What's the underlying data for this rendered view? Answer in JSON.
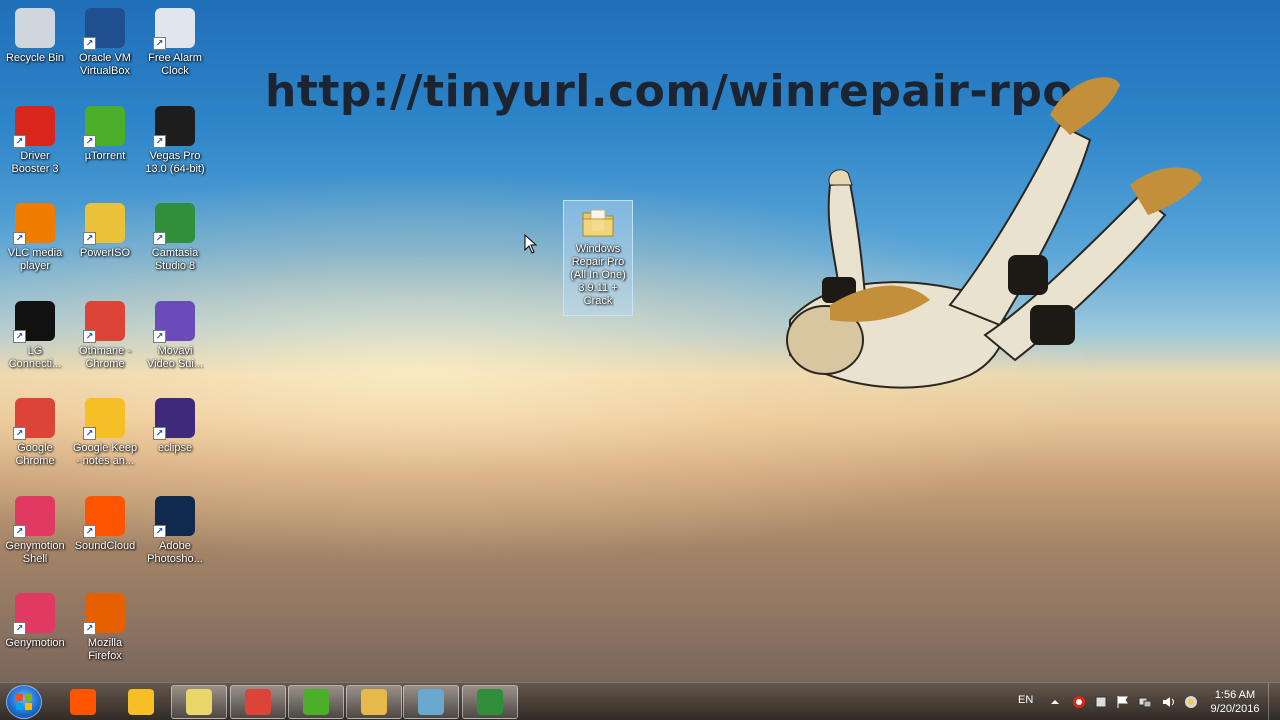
{
  "overlay_url": "http://tinyurl.com/winrepair-rpo",
  "desktop_icons": [
    {
      "label": "Recycle Bin",
      "icon": "recycle-bin-icon",
      "color": "#cfd6dc"
    },
    {
      "label": "Oracle VM\nVirtualBox",
      "icon": "virtualbox-icon",
      "color": "#1f4f8f"
    },
    {
      "label": "Free Alarm\nClock",
      "icon": "alarm-clock-icon",
      "color": "#dfe6ee"
    },
    {
      "label": "Driver\nBooster 3",
      "icon": "driver-booster-icon",
      "color": "#d8261c"
    },
    {
      "label": "µTorrent",
      "icon": "utorrent-icon",
      "color": "#4caf2a"
    },
    {
      "label": "Vegas Pro\n13.0 (64-bit)",
      "icon": "vegas-pro-icon",
      "color": "#1d1d1d"
    },
    {
      "label": "VLC media\nplayer",
      "icon": "vlc-icon",
      "color": "#f07d00"
    },
    {
      "label": "PowerISO",
      "icon": "poweriso-icon",
      "color": "#e9c23a"
    },
    {
      "label": "Camtasia\nStudio 8",
      "icon": "camtasia-icon",
      "color": "#2f8f3a"
    },
    {
      "label": "LG\nConnecti...",
      "icon": "lg-connection-icon",
      "color": "#111111"
    },
    {
      "label": "Othmane -\nChrome",
      "icon": "chrome-profile-icon",
      "color": "#db4437"
    },
    {
      "label": "Movavi\nVideo Sui...",
      "icon": "movavi-icon",
      "color": "#6b4bb8"
    },
    {
      "label": "Google\nChrome",
      "icon": "chrome-icon",
      "color": "#db4437"
    },
    {
      "label": "Google Keep\n- notes an...",
      "icon": "google-keep-icon",
      "color": "#f6bf26"
    },
    {
      "label": "eclipse",
      "icon": "eclipse-icon",
      "color": "#3d2a7a"
    },
    {
      "label": "Genymotion\nShell",
      "icon": "genymotion-shell-icon",
      "color": "#e03a63"
    },
    {
      "label": "SoundCloud",
      "icon": "soundcloud-icon",
      "color": "#ff5500"
    },
    {
      "label": "Adobe\nPhotosho...",
      "icon": "photoshop-icon",
      "color": "#0f2a4d"
    },
    {
      "label": "Genymotion",
      "icon": "genymotion-icon",
      "color": "#e03a63"
    },
    {
      "label": "Mozilla\nFirefox",
      "icon": "firefox-icon",
      "color": "#e66000"
    }
  ],
  "selected_folder": {
    "label": "Windows\nRepair Pro\n(All In One)\n3.9.11 +\nCrack",
    "icon": "folder-icon"
  },
  "taskbar": {
    "start_icon": "windows-start-icon",
    "pinned": [
      {
        "icon": "soundcloud-icon",
        "color": "#ff5500"
      },
      {
        "icon": "google-keep-icon",
        "color": "#f6bf26"
      },
      {
        "icon": "sticky-notes-icon",
        "color": "#e8d66a"
      },
      {
        "icon": "chrome-icon",
        "color": "#db4437"
      },
      {
        "icon": "utorrent-icon",
        "color": "#4caf2a"
      },
      {
        "icon": "file-explorer-icon",
        "color": "#e6b94a"
      },
      {
        "icon": "windows-repair-icon",
        "color": "#6aa8d0"
      },
      {
        "icon": "camtasia-icon",
        "color": "#2f8f3a"
      }
    ],
    "language": "EN",
    "time": "1:56 AM",
    "date": "9/20/2016"
  }
}
